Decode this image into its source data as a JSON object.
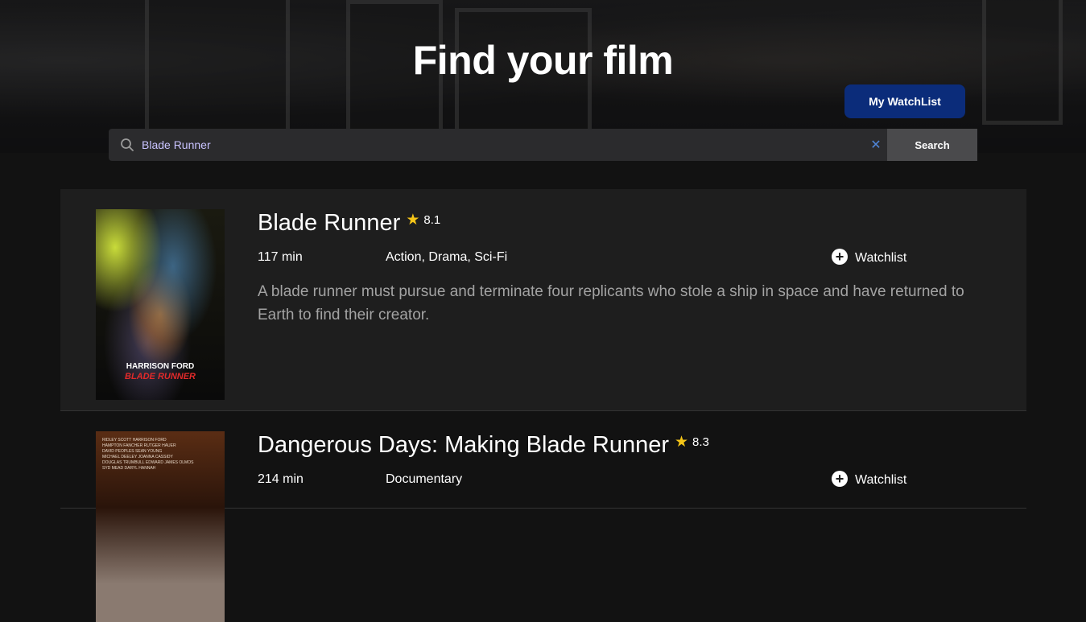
{
  "header": {
    "title": "Find your film",
    "watchlist_button": "My WatchList"
  },
  "search": {
    "value": "Blade Runner",
    "placeholder": "",
    "clear_icon": "close-icon",
    "search_button": "Search"
  },
  "movies": [
    {
      "title": "Blade Runner",
      "rating": "8.1",
      "runtime": "117 min",
      "genres": "Action, Drama, Sci-Fi",
      "plot": "A blade runner must pursue and terminate four replicants who stole a ship in space and have returned to Earth to find their creator.",
      "watchlist_label": "Watchlist",
      "poster_actor": "HARRISON FORD",
      "poster_title": "BLADE RUNNER"
    },
    {
      "title": "Dangerous Days: Making Blade Runner",
      "rating": "8.3",
      "runtime": "214 min",
      "genres": "Documentary",
      "watchlist_label": "Watchlist"
    }
  ],
  "colors": {
    "background": "#121212",
    "card": "#1e1e1e",
    "primary_button": "#0b2c7a",
    "star": "#f5c518",
    "clear_icon": "#4f86d9"
  }
}
